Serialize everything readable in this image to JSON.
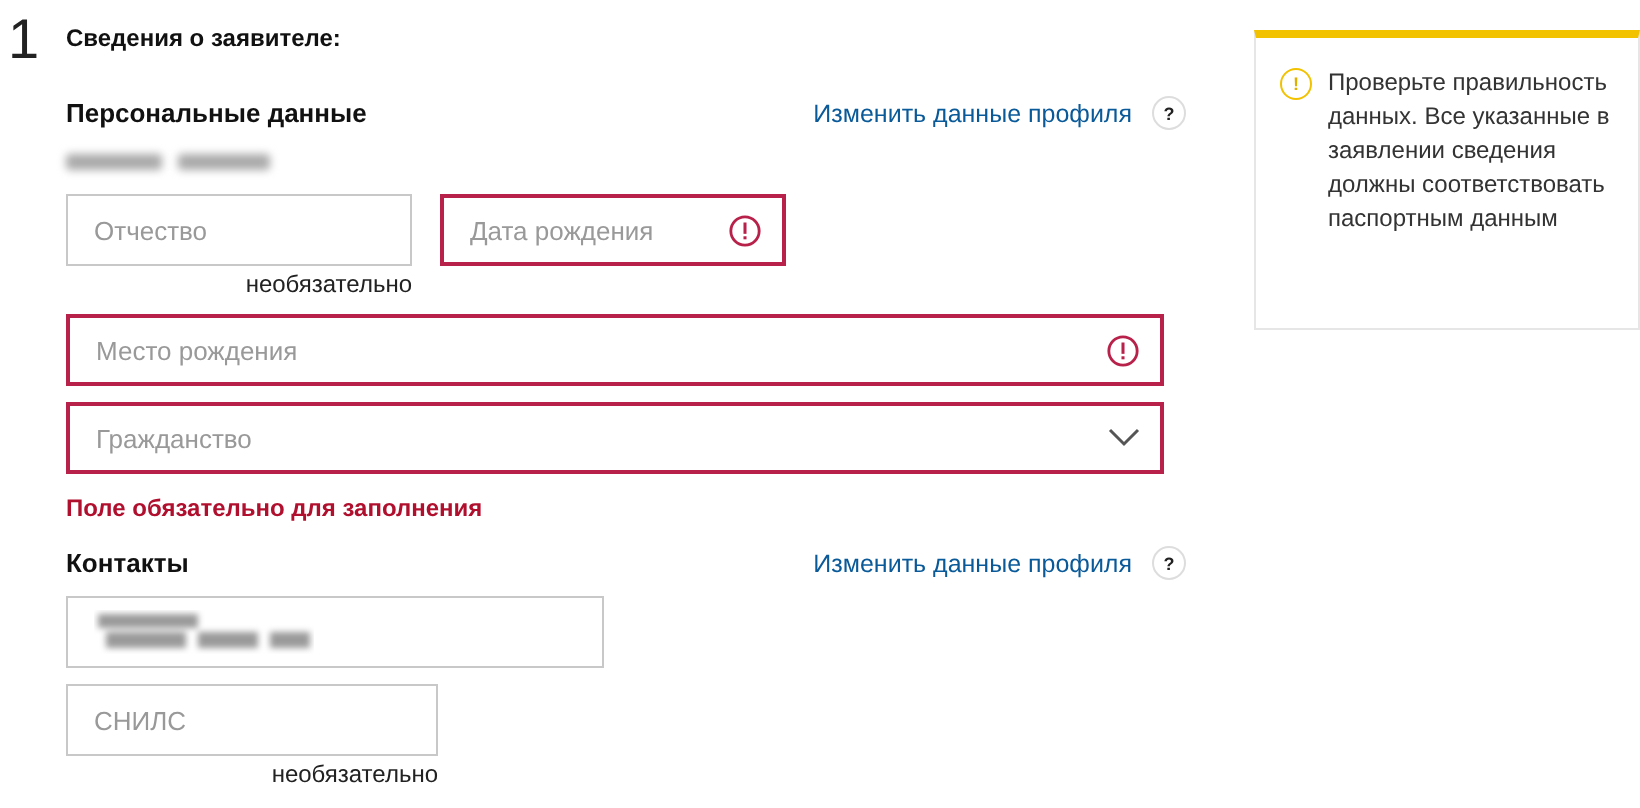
{
  "step": "1",
  "title": "Сведения о заявителе:",
  "personal": {
    "heading": "Персональные данные",
    "link": "Изменить данные профиля",
    "help": "?",
    "rows": [
      [
        {
          "kind": "text",
          "placeholder": "Отчество",
          "error": false,
          "hint": "необязательно"
        },
        {
          "kind": "text",
          "placeholder": "Дата рождения",
          "error": true
        }
      ],
      [
        {
          "kind": "text",
          "placeholder": "Место рождения",
          "error": true
        }
      ],
      [
        {
          "kind": "select",
          "placeholder": "Гражданство",
          "error": true
        }
      ]
    ],
    "error_message": "Поле обязательно для заполнения"
  },
  "contacts": {
    "heading": "Контакты",
    "link": "Изменить данные профиля",
    "help": "?",
    "rows": [
      [
        {
          "kind": "blurred",
          "error": false
        }
      ],
      [
        {
          "kind": "text",
          "placeholder": "СНИЛС",
          "error": false,
          "hint": "необязательно"
        }
      ]
    ]
  },
  "notice": {
    "icon": "!",
    "text": "Проверьте правильность данных. Все указанные в заявлении сведения должны соответствовать паспортным данным"
  }
}
